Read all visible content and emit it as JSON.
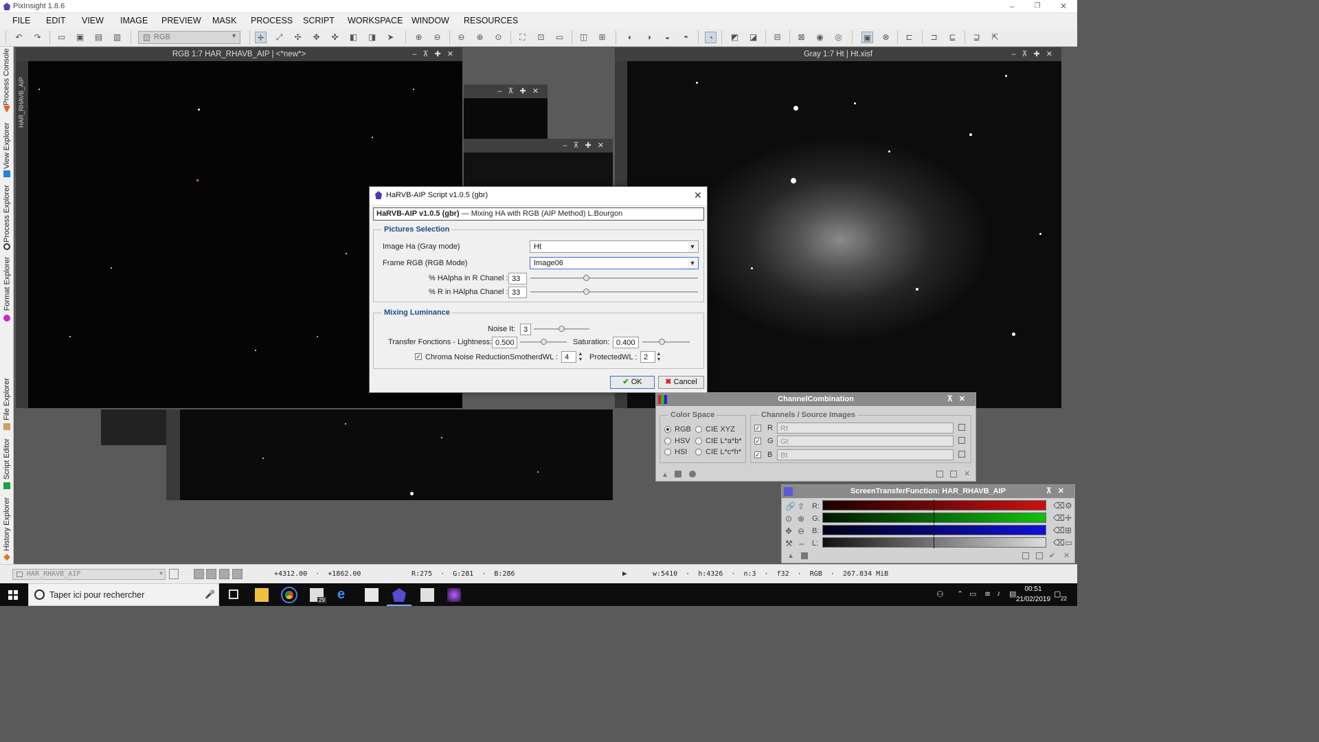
{
  "app": {
    "title": "PixInsight 1.8.6"
  },
  "menu": [
    "FILE",
    "EDIT",
    "VIEW",
    "IMAGE",
    "PREVIEW",
    "MASK",
    "PROCESS",
    "SCRIPT",
    "WORKSPACE",
    "WINDOW",
    "RESOURCES"
  ],
  "toolbar": {
    "view_combo": "RGB"
  },
  "side_tabs": [
    "Process Console",
    "HAR_RHAVB_AIP",
    "View Explorer",
    "Process Explorer",
    "Format Explorer",
    "File Explorer",
    "Script Editor",
    "History Explorer"
  ],
  "windows": {
    "left_title": "RGB 1:7 HAR_RHAVB_AIP | <*new*>",
    "right_title": "Gray 1:7 Ht | Ht.xisf"
  },
  "dialog": {
    "title": "HaRVB-AIP Script v1.0.5 (gbr)",
    "header_bold": "HaRVB-AIP v1.0.5 (gbr)",
    "header_rest": " — Mixing HA with RGB (AIP Method) L.Bourgon",
    "pictures_group": "Pictures Selection",
    "image_ha_label": "Image Ha (Gray mode)",
    "image_ha_value": "Ht",
    "frame_rgb_label": "Frame RGB (RGB Mode)",
    "frame_rgb_value": "Image06",
    "halpha_in_r_label": "% HAlpha in R Chanel :",
    "halpha_in_r_value": "33",
    "halpha_in_r_fraction": 0.33,
    "r_in_halpha_label": "% R in HAlpha Chanel :",
    "r_in_halpha_value": "33",
    "r_in_halpha_fraction": 0.33,
    "mixing_group": "Mixing Luminance",
    "noise_label": "Noise It:",
    "noise_value": "3",
    "transfer_label": "Transfer Fonctions - Lightness:",
    "transfer_value": "0.500",
    "saturation_label": "Saturation:",
    "saturation_value": "0.400",
    "chroma_label": "Chroma Noise Reduction",
    "smoothered_label": "SmotherdWL :",
    "smoothered_value": "4",
    "protected_label": "ProtectedWL :",
    "protected_value": "2",
    "ok_label": "OK",
    "cancel_label": "Cancel"
  },
  "channel_combination": {
    "title": "ChannelCombination",
    "color_space_group": "Color Space",
    "spaces": [
      "RGB",
      "HSV",
      "HSI",
      "CIE XYZ",
      "CIE L*a*b*",
      "CIE L*c*h*"
    ],
    "channels_group": "Channels / Source Images",
    "channels": [
      {
        "label": "R",
        "source": "Rt"
      },
      {
        "label": "G",
        "source": "Gt"
      },
      {
        "label": "B",
        "source": "Bt"
      }
    ]
  },
  "stf": {
    "title": "ScreenTransferFunction: HAR_RHAVB_AIP",
    "rows": [
      "R:",
      "G:",
      "B:",
      "L:"
    ]
  },
  "status": {
    "view": "HAR_RHAVB_AIP",
    "coords": "+4312.00  ·  +1862.00",
    "rgb": "R:275  ·  G:281  ·  B:286",
    "info": "w:5410  ·  h:4326  ·  n:3  ·  f32  ·  RGB  ·  267.834 MiB"
  },
  "taskbar": {
    "search_placeholder": "Taper ici pour rechercher",
    "mail_badge": "29",
    "time": "00:51",
    "date": "21/02/2019",
    "notif": "22"
  },
  "colors": {
    "accent": "#1a4c8c",
    "red": "#cc1111",
    "green": "#10c010",
    "blue": "#1010d8"
  }
}
